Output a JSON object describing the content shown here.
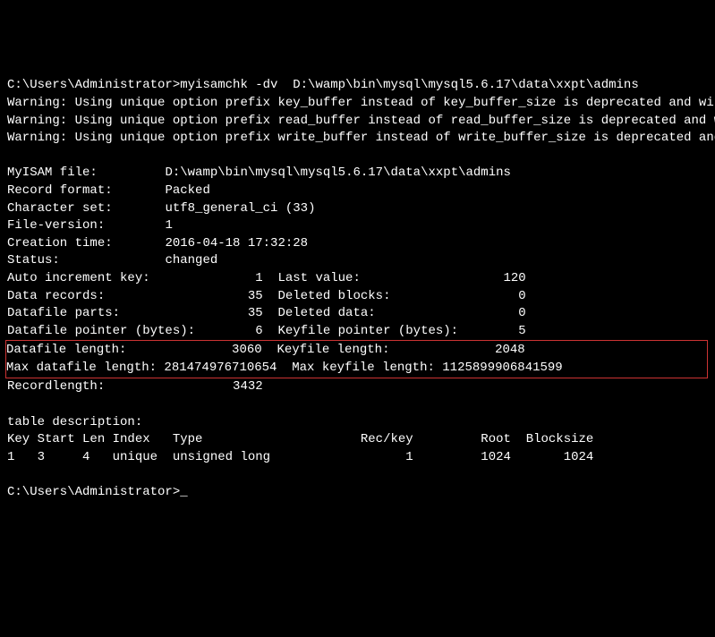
{
  "prompt1": "C:\\Users\\Administrator>",
  "command": "myisamchk -dv  D:\\wamp\\bin\\mysql\\mysql5.6.17\\data\\xxpt\\admins",
  "warnings": {
    "w1": "Warning: Using unique option prefix key_buffer instead of key_buffer_size is deprecated and will be removed in a future release. Please use the full name instead.",
    "w2": "Warning: Using unique option prefix read_buffer instead of read_buffer_size is deprecated and will be removed in a future release. Please use the full name instead.",
    "w3": "Warning: Using unique option prefix write_buffer instead of write_buffer_size is deprecated and will be removed in a future release. Please use the full name instead."
  },
  "info": {
    "myisam_file_label": "MyISAM file:         ",
    "myisam_file_value": "D:\\wamp\\bin\\mysql\\mysql5.6.17\\data\\xxpt\\admins",
    "record_format_label": "Record format:       ",
    "record_format_value": "Packed",
    "charset_label": "Character set:       ",
    "charset_value": "utf8_general_ci (33)",
    "file_version_label": "File-version:        ",
    "file_version_value": "1",
    "creation_time_label": "Creation time:       ",
    "creation_time_value": "2016-04-18 17:32:28",
    "status_label": "Status:              ",
    "status_value": "changed",
    "auto_increment_line": "Auto increment key:              1  Last value:                   120",
    "data_records_line": "Data records:                   35  Deleted blocks:                 0",
    "datafile_parts_line": "Datafile parts:                 35  Deleted data:                   0",
    "datafile_ptr_line": "Datafile pointer (bytes):        6  Keyfile pointer (bytes):        5",
    "datafile_len_line": "Datafile length:              3060  Keyfile length:              2048",
    "max_datafile_line": "Max datafile length: 281474976710654  Max keyfile length: 1125899906841599",
    "recordlength_line": "Recordlength:                 3432"
  },
  "table_desc": {
    "header": "table description:",
    "columns": "Key Start Len Index   Type                     Rec/key         Root  Blocksize",
    "row1": "1   3     4   unique  unsigned long                  1         1024       1024"
  },
  "prompt2": "C:\\Users\\Administrator>",
  "cursor": "_"
}
